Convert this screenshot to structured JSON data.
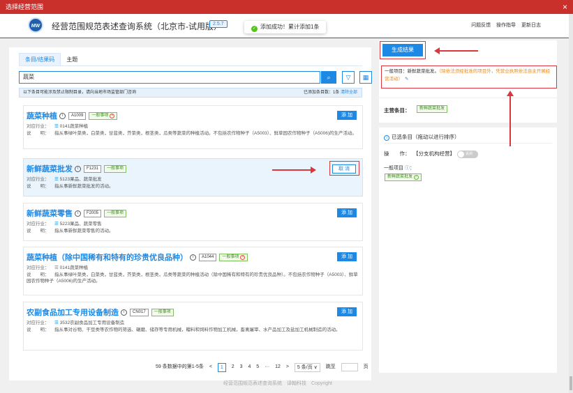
{
  "window": {
    "title": "选择经营范围",
    "close": "×"
  },
  "header": {
    "logo_text": "MW",
    "app_title": "经营范围规范表述查询系统（北京市-试用版）",
    "version": "2.5.7",
    "links": [
      "问题反馈",
      "操作指导",
      "更新日志"
    ]
  },
  "toast": {
    "icon": "✓",
    "message": "添加成功！累计添加1条"
  },
  "left": {
    "tabs": [
      {
        "label": "条目/结果码"
      },
      {
        "label": "主题"
      }
    ],
    "search": {
      "value": "蔬菜",
      "search_icon": "⌕",
      "filter_icon": "▽",
      "grid_icon": "▦"
    },
    "info": {
      "notice": "以下条目可能涉及禁止限制目录，请向当地市场监管部门咨询",
      "added_label": "已添加条目数：",
      "added_count": "1条",
      "clear_all": "清除全部"
    },
    "industry_key": "对应行业：",
    "desc_key": "说　　明：",
    "industry_icon": "☰",
    "cards": [
      {
        "name": "蔬菜种植",
        "code": "A1009",
        "tag": "一般事项",
        "tag_x": "×",
        "button": "添 加",
        "industry": "0141蔬菜种植",
        "desc": "指从事绿叶菜类，白菜类，甘蓝类，芥菜类，根茎类，瓜类等蔬菜的种植活动。不包括农作物种子（A5003）、鲜草园农作物种子（A5006)的生产活动。"
      },
      {
        "name": "新鲜蔬菜批发",
        "code": "F1231",
        "tag": "一般事项",
        "tag_x": "",
        "button": "取 消",
        "industry": "5123果品、蔬菜批发",
        "desc": "指从事新鲜蔬菜批发的活动。"
      },
      {
        "name": "新鲜蔬菜零售",
        "code": "F2005",
        "tag": "一般事项",
        "tag_x": "",
        "button": "添 加",
        "industry": "5223果品、蔬菜零售",
        "desc": "指从事新鲜蔬菜零售的活动。"
      },
      {
        "name": "蔬菜种植（除中国稀有和特有的珍贵优良品种）",
        "code": "A1044",
        "tag": "一般事项",
        "tag_x": "×",
        "button": "添 加",
        "industry": "0141蔬菜种植",
        "desc": "指从事绿叶菜类，白菜类，甘蓝类，芥菜类，根茎类，瓜类等蔬菜的种植活动（除中国稀有和特有的珍贵优良品种）。不包括农作物种子（A5003）、鲜草园农作物种子（A5006)的生产活动。"
      },
      {
        "name": "农副食品加工专用设备制造",
        "code": "CN017",
        "tag": "一般事项",
        "tag_x": "",
        "button": "添 加",
        "industry": "3532农副食品加工专用设备制造",
        "desc": "指从事对谷物、干豆类等农作物的筛选、碾磨、储存等专用机械，糧料和饲料作物加工机械，畜禽屠宰、水产品加工及盐加工机械制造的活动。"
      }
    ],
    "pager": {
      "summary": "59 条数据中的第1-5条",
      "prev": "<",
      "pages": [
        "1",
        "2",
        "3",
        "4",
        "5",
        "···",
        "12"
      ],
      "next": ">",
      "page_size": "5 条/页 ∨",
      "jump_label": "跳至",
      "page_unit": "页"
    }
  },
  "right": {
    "generate_button": "生成结果",
    "general_prefix": "一般项目：新鲜蔬菜批发。",
    "general_note": "（除依法须经批准的项目外，凭营业执照依法自主开展经营活动）",
    "edit_icon": "✎",
    "main_label": "主营条目：",
    "main_tag": "新鲜蔬菜批发",
    "selected_title": "已选条目（拖动以进行排序）",
    "info_icon": "i",
    "op_label": "操　　作：",
    "op_value": "【分支机构经营】",
    "switch_state": "关闭",
    "general_label": "一般项目",
    "general_q": "ⓘ",
    "general_colon": "：",
    "selected_tag": "新鲜蔬菜批发",
    "selected_ok": "✓"
  },
  "footer": "经营范围规范表述查询系统　译翰科技　Copyright"
}
